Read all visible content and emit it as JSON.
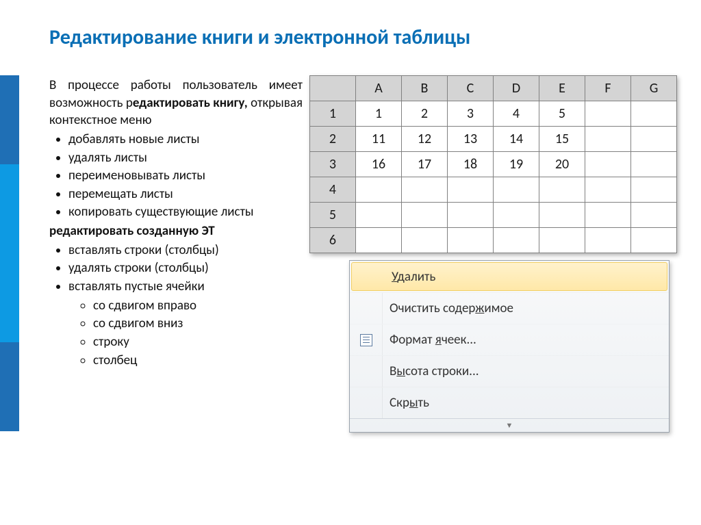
{
  "title": "Редактирование книги и электронной таблицы",
  "left": {
    "intro_pre": "В процессе работы пользователь имеет возможность р",
    "intro_bold": "едактировать книгу,",
    "intro_post": " открывая контекстное меню",
    "list1": [
      "добавлять новые листы",
      "удалять листы",
      "переименовывать листы",
      "перемещать листы",
      "копировать существующие листы"
    ],
    "subhead": "редактировать созданную ЭТ",
    "list2": [
      "вставлять строки (столбцы)",
      "удалять строки (столбцы)",
      "вставлять пустые ячейки"
    ],
    "list3": [
      "со сдвигом вправо",
      "со сдвигом вниз",
      "строку",
      "столбец"
    ]
  },
  "sheet": {
    "cols": [
      "A",
      "B",
      "C",
      "D",
      "E",
      "F",
      "G"
    ],
    "rows": [
      "1",
      "2",
      "3",
      "4",
      "5",
      "6"
    ],
    "data": [
      [
        "1",
        "2",
        "3",
        "4",
        "5",
        "",
        ""
      ],
      [
        "11",
        "12",
        "13",
        "14",
        "15",
        "",
        ""
      ],
      [
        "16",
        "17",
        "18",
        "19",
        "20",
        "",
        ""
      ],
      [
        "",
        "",
        "",
        "",
        "",
        "",
        ""
      ],
      [
        "",
        "",
        "",
        "",
        "",
        "",
        ""
      ],
      [
        "",
        "",
        "",
        "",
        "",
        "",
        ""
      ]
    ]
  },
  "ctx": {
    "items": [
      {
        "label_pre": "",
        "u": "У",
        "label_post": "далить",
        "selected": true,
        "icon": ""
      },
      {
        "label_pre": "Очистить содер",
        "u": "ж",
        "label_post": "имое",
        "selected": false,
        "icon": ""
      },
      {
        "label_pre": "Формат ",
        "u": "я",
        "label_post": "чеек...",
        "selected": false,
        "icon": "fmt"
      },
      {
        "label_pre": "В",
        "u": "ы",
        "label_post": "сота строки...",
        "selected": false,
        "icon": ""
      },
      {
        "label_pre": "Скр",
        "u": "ы",
        "label_post": "ть",
        "selected": false,
        "icon": ""
      }
    ],
    "tail": "▼"
  }
}
